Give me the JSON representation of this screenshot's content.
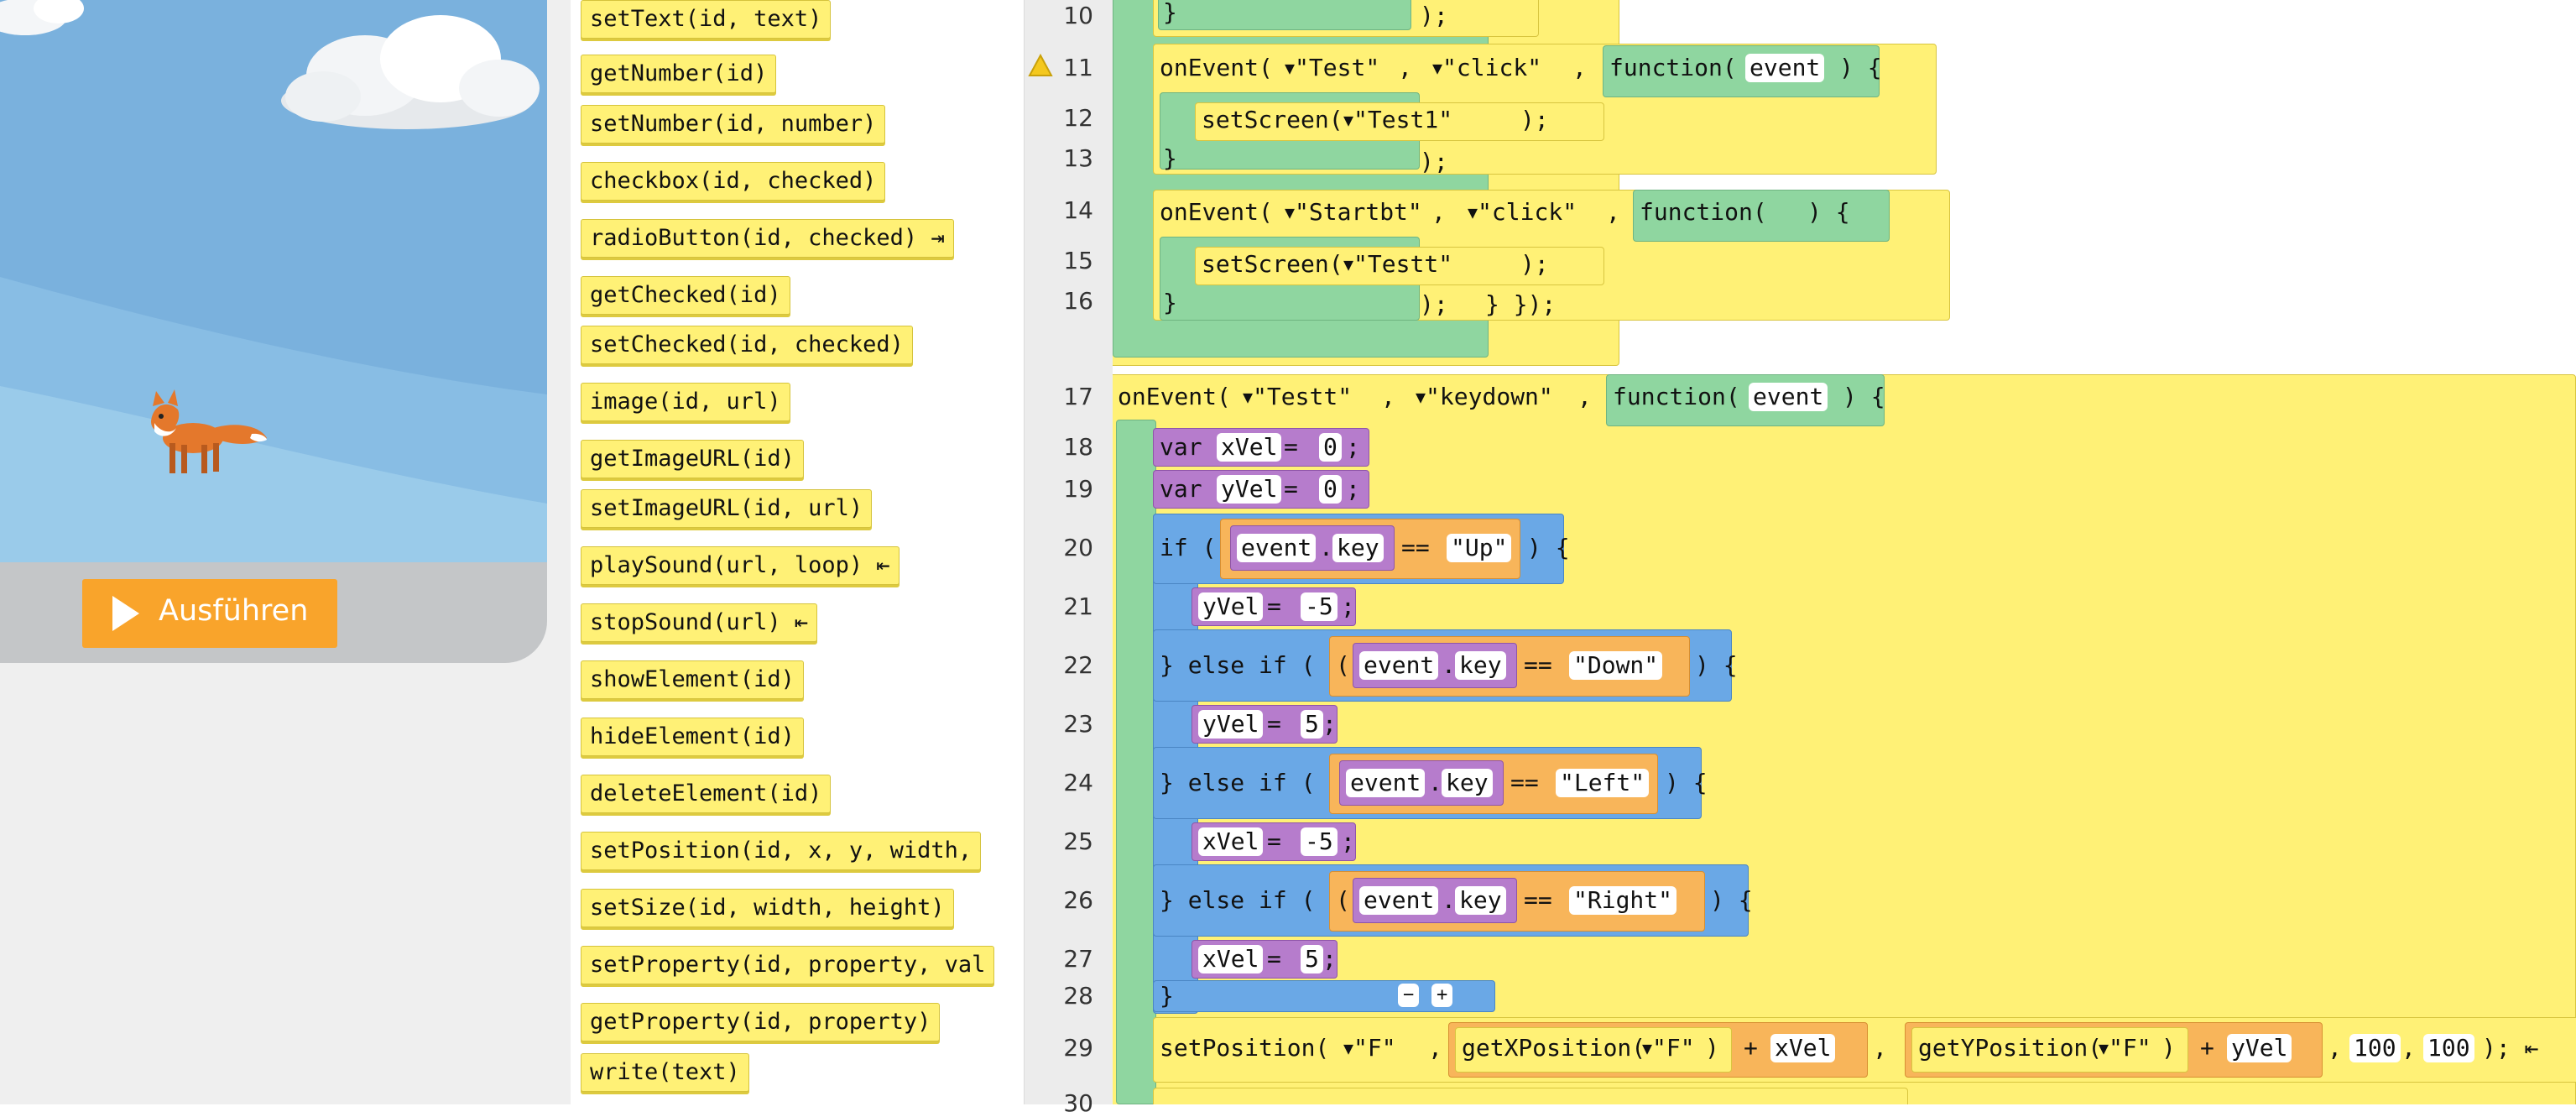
{
  "stage": {
    "run_button_label": "Ausführen",
    "play_icon": "play-icon",
    "sky_color": "#7ab1dd",
    "run_color": "#f9a42b"
  },
  "toolbox": {
    "blocks": [
      "setText(id, text)",
      "getNumber(id)",
      "setNumber(id, number)",
      "checkbox(id, checked)",
      "radioButton(id, checked) ⇥",
      "getChecked(id)",
      "setChecked(id, checked)",
      "image(id, url)",
      "getImageURL(id)",
      "setImageURL(id, url)",
      "playSound(url, loop) ⇤",
      "stopSound(url) ⇤",
      "showElement(id)",
      "hideElement(id)",
      "deleteElement(id)",
      "setPosition(id, x, y, width,",
      "setSize(id, width, height)",
      "setProperty(id, property, val",
      "getProperty(id, property)",
      "write(text)"
    ]
  },
  "gutter": {
    "lines": [
      "10",
      "11",
      "12",
      "13",
      "14",
      "15",
      "16",
      "17",
      "18",
      "19",
      "20",
      "21",
      "22",
      "23",
      "24",
      "25",
      "26",
      "27",
      "28",
      "29",
      "30"
    ]
  },
  "code": {
    "l10_close": ");",
    "l11": {
      "kw": "onEvent(",
      "id": "\"Test\"",
      "ev": "\"click\"",
      "fn": "function(",
      "param": "event",
      "end": ") {"
    },
    "l12": {
      "call": "setScreen(",
      "arg": "\"Test1\"",
      "end": ");"
    },
    "l13_close": ");",
    "l14": {
      "kw": "onEvent(",
      "id": "\"Startbt\"",
      "ev": "\"click\"",
      "fn": "function(",
      "end": ") {"
    },
    "l15": {
      "call": "setScreen(",
      "arg": "\"Testt\"",
      "end": ");"
    },
    "l16_close": ");",
    "l16_close2": "} });",
    "l17": {
      "kw": "onEvent(",
      "id": "\"Testt\"",
      "ev": "\"keydown\"",
      "fn": "function(",
      "param": "event",
      "end": ") {"
    },
    "l18": {
      "kw": "var",
      "name": "xVel",
      "eq": "=",
      "val": "0",
      "end": ";"
    },
    "l19": {
      "kw": "var",
      "name": "yVel",
      "eq": "=",
      "val": "0",
      "end": ";"
    },
    "l20": {
      "kw": "if (",
      "obj": "event",
      "prop": "key",
      "op": "==",
      "str": "\"Up\"",
      "end": ") {"
    },
    "l21": {
      "name": "yVel",
      "eq": "=",
      "val": "-5",
      "end": ";"
    },
    "l22": {
      "kw": "} else if (",
      "obj": "event",
      "prop": "key",
      "op": "==",
      "str": "\"Down\"",
      "end": ") {"
    },
    "l23": {
      "name": "yVel",
      "eq": "=",
      "val": "5",
      "end": ";"
    },
    "l24": {
      "kw": "} else if (",
      "obj": "event",
      "prop": "key",
      "op": "==",
      "str": "\"Left\"",
      "end": ") {"
    },
    "l25": {
      "name": "xVel",
      "eq": "=",
      "val": "-5",
      "end": ";"
    },
    "l26": {
      "kw": "} else if (",
      "obj": "event",
      "prop": "key",
      "op": "==",
      "str": "\"Right\"",
      "end": ") {"
    },
    "l27": {
      "name": "xVel",
      "eq": "=",
      "val": "5",
      "end": ";"
    },
    "l28": {
      "close": "}",
      "minus": "−",
      "plus": "+"
    },
    "l29": {
      "call": "setPosition(",
      "id": "\"F\"",
      "getx": "getXPosition(",
      "gety": "getYPosition(",
      "arg": "\"F\"",
      "plus": "+",
      "xvar": "xVel",
      "yvar": "yVel",
      "w": "100",
      "h": "100",
      "end": "); ⇤"
    }
  }
}
